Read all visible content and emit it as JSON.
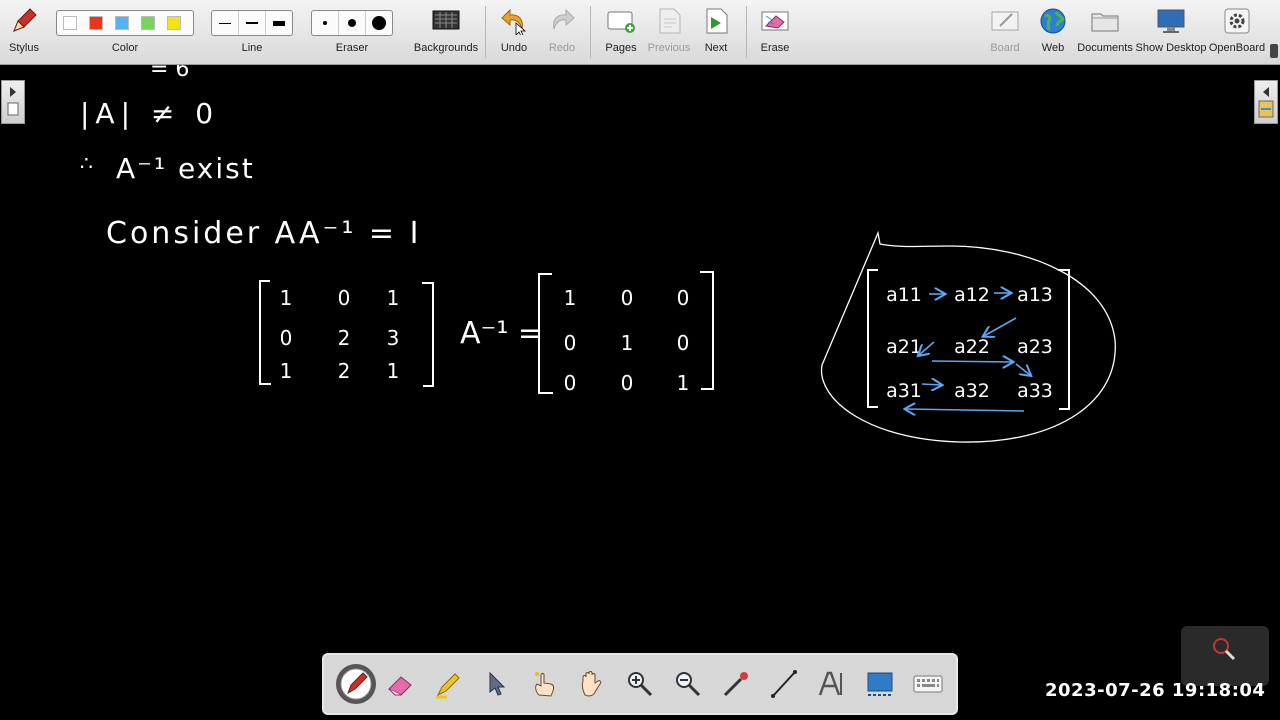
{
  "toolbar": {
    "stylus": "Stylus",
    "color": "Color",
    "colors": [
      "#ffffff",
      "#e8351c",
      "#54b4f0",
      "#77d65a",
      "#f2e316"
    ],
    "line": "Line",
    "eraser": "Eraser",
    "backgrounds": "Backgrounds",
    "undo": "Undo",
    "redo": "Redo",
    "pages": "Pages",
    "previous": "Previous",
    "next": "Next",
    "erase": "Erase",
    "board": "Board",
    "web": "Web",
    "documents": "Documents",
    "show_desktop": "Show Desktop",
    "openboard": "OpenBoard"
  },
  "board": {
    "ink_color": "#ffffff",
    "arrow_color": "#5aa6f0",
    "partial_top": "= 6",
    "det_statement": "|A| ≠ 0",
    "therefore": "∴",
    "inverse_exists": "A⁻¹ exist",
    "consider": "Consider AA⁻¹ = I",
    "matrix_a": [
      [
        "1",
        "0",
        "1"
      ],
      [
        "0",
        "2",
        "3"
      ],
      [
        "1",
        "2",
        "1"
      ]
    ],
    "a_inverse": "A⁻¹ =",
    "identity": [
      [
        "1",
        "0",
        "0"
      ],
      [
        "0",
        "1",
        "0"
      ],
      [
        "0",
        "0",
        "1"
      ]
    ],
    "order_diagram": [
      [
        "a11",
        "a12",
        "a13"
      ],
      [
        "a21",
        "a22",
        "a23"
      ],
      [
        "a31",
        "a32",
        "a33"
      ]
    ]
  },
  "timestamp": "2023-07-26  19:18:04"
}
